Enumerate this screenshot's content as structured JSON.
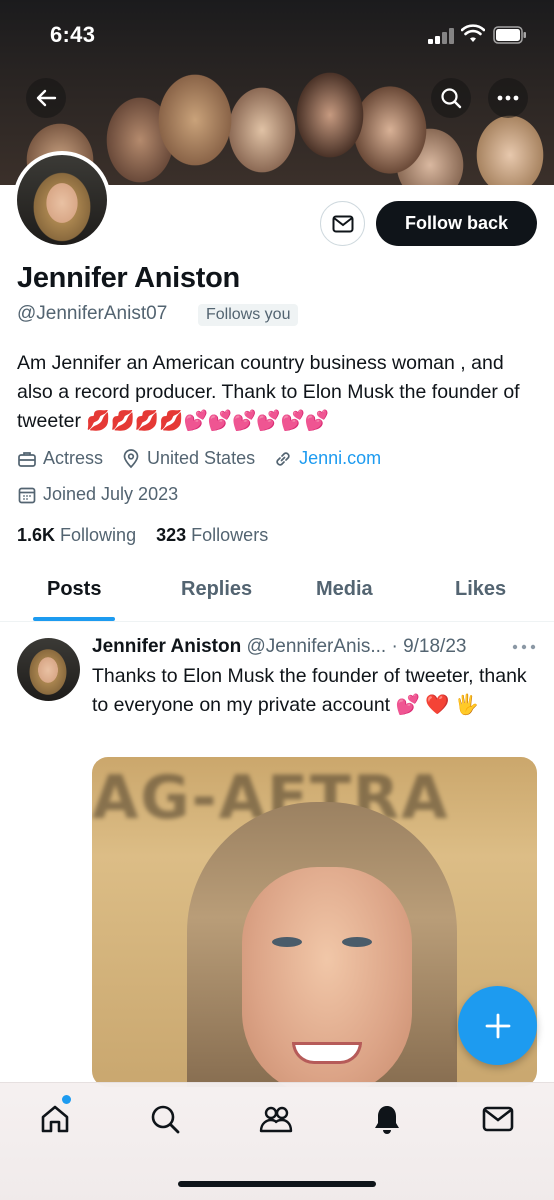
{
  "status_bar": {
    "time": "6:43"
  },
  "profile": {
    "display_name": "Jennifer Aniston",
    "handle": "@JenniferAnist07",
    "follows_you": "Follows you",
    "follow_back_label": "Follow back",
    "bio": "Am Jennifer an American country business woman , and also a record producer. Thank to Elon Musk the founder of tweeter 💋💋💋💋💕💕💕💕💕💕",
    "profession": "Actress",
    "location": "United States",
    "website": "Jenni.com",
    "joined": "Joined July 2023",
    "following_count": "1.6K",
    "following_label": "Following",
    "followers_count": "323",
    "followers_label": "Followers"
  },
  "tabs": [
    {
      "label": "Posts"
    },
    {
      "label": "Replies"
    },
    {
      "label": "Media"
    },
    {
      "label": "Likes"
    }
  ],
  "tweet": {
    "name": "Jennifer Aniston",
    "handle": "@JenniferAnis...",
    "separator": " · ",
    "date": "9/18/23",
    "text": "Thanks to Elon Musk the founder of tweeter, thank to everyone on my private account 💕 ❤️ 🖐️",
    "image_backdrop_text": "AG-AFTRA"
  },
  "colors": {
    "accent": "#1d9bf0",
    "text": "#0f1419",
    "muted": "#536471"
  },
  "icons": {
    "back": "arrow-left-icon",
    "search": "search-icon",
    "more": "more-icon",
    "message": "mail-icon",
    "profession": "briefcase-icon",
    "location": "location-pin-icon",
    "website": "link-icon",
    "joined": "calendar-icon",
    "compose": "plus-icon",
    "nav": [
      "home-icon",
      "search-icon",
      "communities-icon",
      "notifications-icon",
      "messages-icon"
    ]
  }
}
